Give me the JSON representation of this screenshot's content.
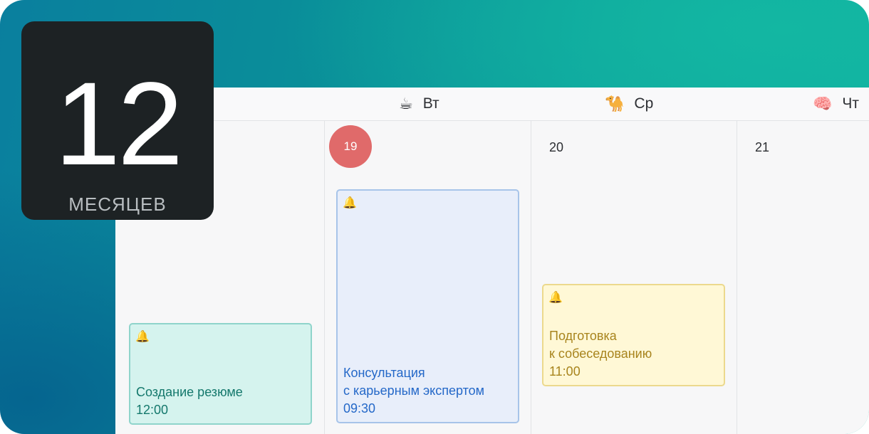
{
  "badge": {
    "number": "12",
    "label": "МЕСЯЦЕВ"
  },
  "calendar": {
    "days": [
      {
        "emoji": "☕",
        "name": "Вт",
        "date": "19",
        "today": true
      },
      {
        "emoji": "🐪",
        "name": "Ср",
        "date": "20",
        "today": false
      },
      {
        "emoji": "🧠",
        "name": "Чт",
        "date": "21",
        "today": false
      }
    ],
    "events": [
      {
        "icon": "bell-icon",
        "bell": "🔔",
        "title_lines": [
          "Создание резюме"
        ],
        "time": "12:00",
        "color": "#d5f3ee"
      },
      {
        "icon": "bell-icon",
        "bell": "🔔",
        "title_lines": [
          "Консультация",
          "с карьерным экспертом"
        ],
        "time": "09:30",
        "color": "#e8eefa"
      },
      {
        "icon": "bell-icon",
        "bell": "🔔",
        "title_lines": [
          "Подготовка",
          "к собеседованию"
        ],
        "time": "11:00",
        "color": "#fff8d6"
      }
    ]
  },
  "colors": {
    "today_marker": "#e06a6a",
    "background_gradient_start": "#0a7f9e",
    "background_gradient_end": "#12b4a3",
    "badge_background": "#1d2224"
  }
}
